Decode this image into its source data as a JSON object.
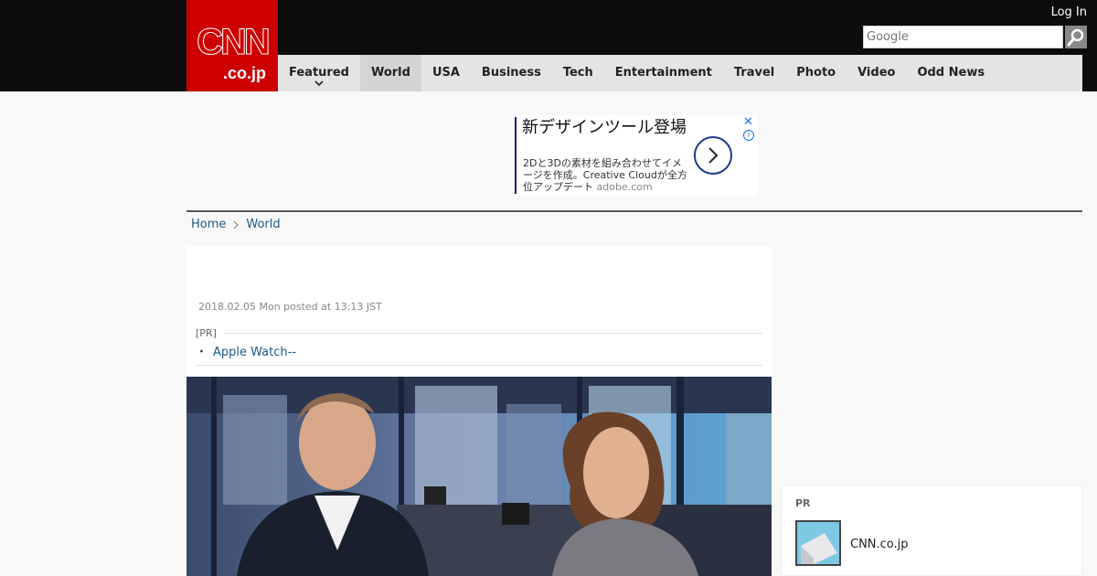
{
  "header": {
    "logo_main": "CNN",
    "logo_sub": ".co.jp",
    "login_label": "Log In",
    "search_placeholder": "Google",
    "nav": [
      {
        "label": "Featured"
      },
      {
        "label": "World"
      },
      {
        "label": "USA"
      },
      {
        "label": "Business"
      },
      {
        "label": "Tech"
      },
      {
        "label": "Entertainment"
      },
      {
        "label": "Travel"
      },
      {
        "label": "Photo"
      },
      {
        "label": "Video"
      },
      {
        "label": "Odd News"
      }
    ],
    "active_nav": "World"
  },
  "ad": {
    "title": "新デザインツール登場",
    "body": "2Dと3Dの素材を組み合わせてイメージを作成。Creative Cloudが全方位アップデート",
    "domain": "adobe.com",
    "close": "✕",
    "info": "i"
  },
  "breadcrumb": {
    "home": "Home",
    "current": "World"
  },
  "article": {
    "date": "2018.02.05 Mon posted at 13:13 JST",
    "pr_label": "[PR]",
    "pr_bullet": "・",
    "pr_link": "Apple Watch--"
  },
  "side_pr": {
    "label": "PR",
    "name": "CNN.co.jp"
  },
  "colors": {
    "brand_red": "#cc0000",
    "link_blue": "#1a5a8a",
    "header_black": "#0c0c0c",
    "nav_gray": "#e4e4e4"
  },
  "icons": {
    "search": "search-icon",
    "chevron": "chevron-down-icon",
    "ad_arrow": "chevron-right-icon",
    "breadcrumb_sep": "chevron-right-icon"
  }
}
